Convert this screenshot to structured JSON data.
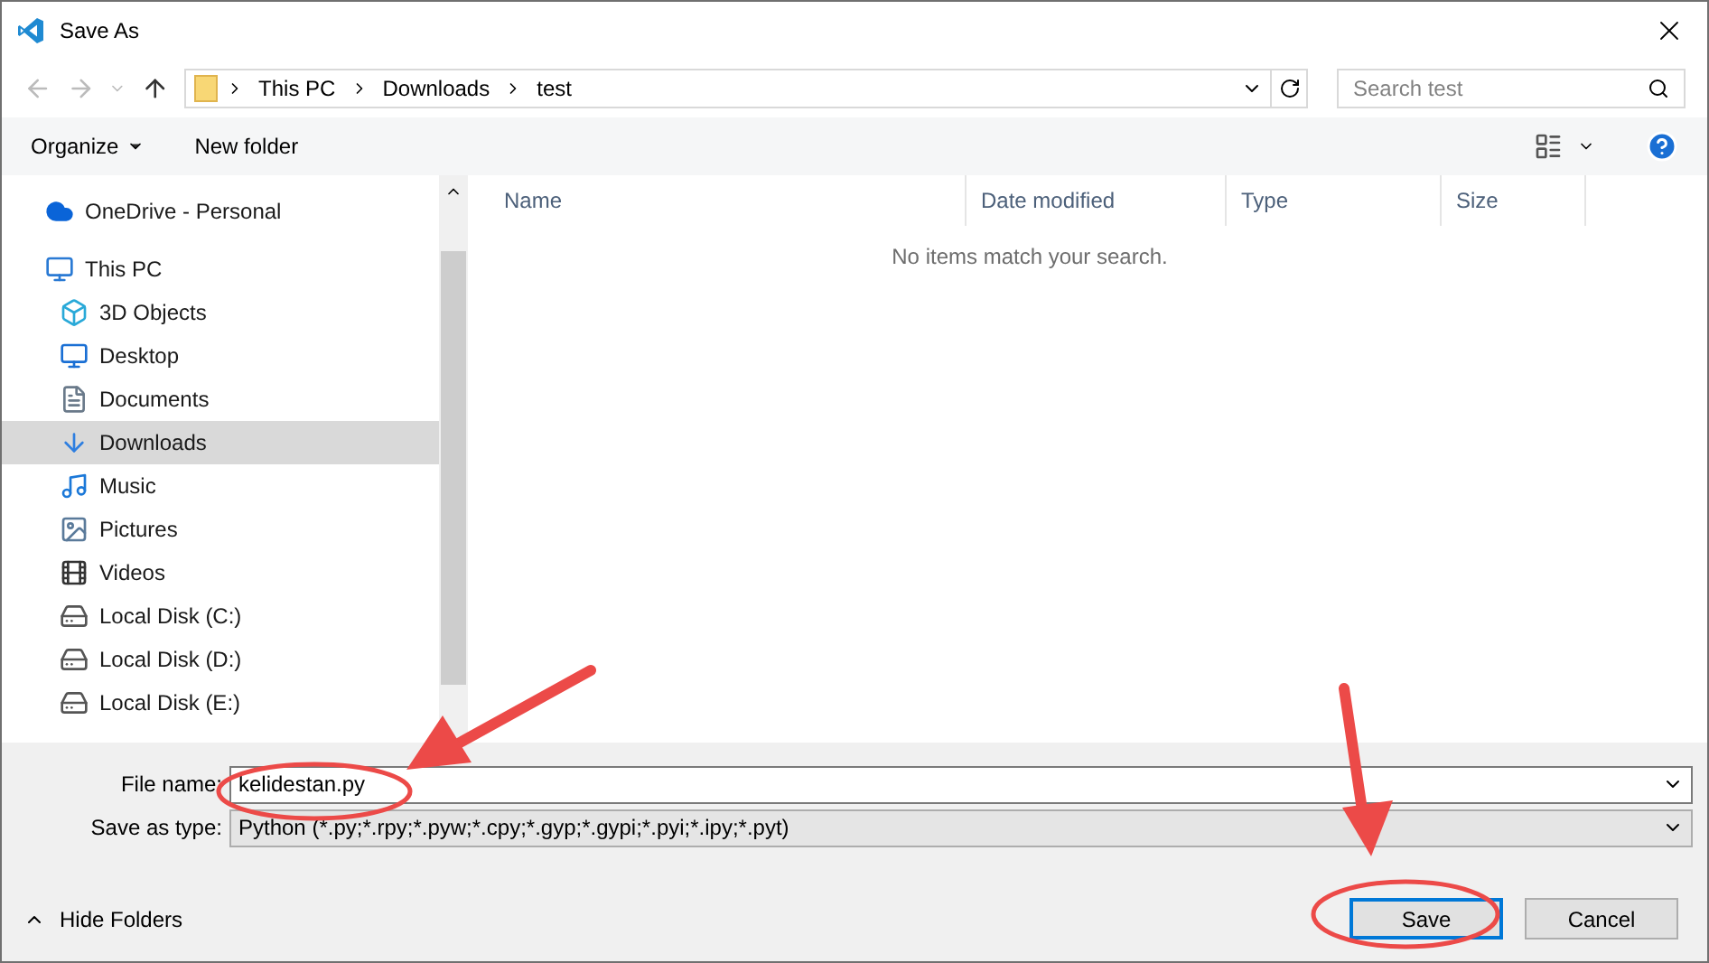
{
  "window": {
    "title": "Save As"
  },
  "breadcrumb": [
    "This PC",
    "Downloads",
    "test"
  ],
  "search": {
    "placeholder": "Search test"
  },
  "toolbar": {
    "organize": "Organize",
    "new_folder": "New folder"
  },
  "sidebar": {
    "items": [
      {
        "label": "OneDrive - Personal",
        "selected": false
      },
      {
        "label": "This PC",
        "selected": false,
        "children": [
          {
            "label": "3D Objects",
            "selected": false
          },
          {
            "label": "Desktop",
            "selected": false
          },
          {
            "label": "Documents",
            "selected": false
          },
          {
            "label": "Downloads",
            "selected": true
          },
          {
            "label": "Music",
            "selected": false
          },
          {
            "label": "Pictures",
            "selected": false
          },
          {
            "label": "Videos",
            "selected": false
          },
          {
            "label": "Local Disk (C:)",
            "selected": false
          },
          {
            "label": "Local Disk (D:)",
            "selected": false
          },
          {
            "label": "Local Disk (E:)",
            "selected": false
          }
        ]
      }
    ]
  },
  "table": {
    "columns": [
      "Name",
      "Date modified",
      "Type",
      "Size"
    ],
    "empty_message": "No items match your search."
  },
  "form": {
    "file_name_label": "File name:",
    "file_name": "kelidestan.py",
    "type_label": "Save as type:",
    "type_value": "Python (*.py;*.rpy;*.pyw;*.cpy;*.gyp;*.gypi;*.pyi;*.ipy;*.pyt)"
  },
  "hide_folders": "Hide Folders",
  "buttons": [
    {
      "label": "Save",
      "kind": "primary"
    },
    {
      "label": "Cancel",
      "kind": "normal"
    }
  ]
}
